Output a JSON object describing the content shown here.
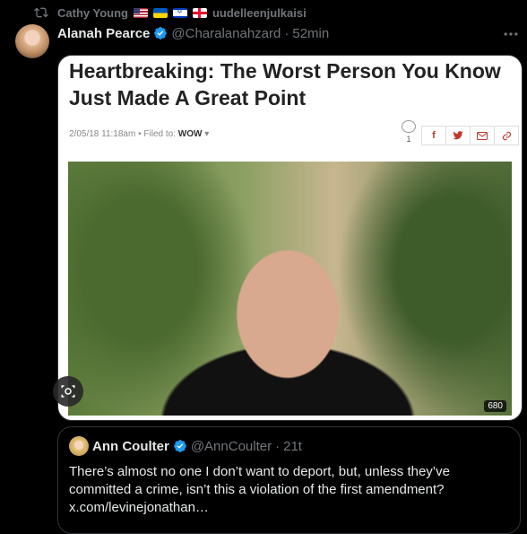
{
  "repost": {
    "user": "Cathy Young",
    "flags": [
      "us",
      "ua",
      "il",
      "ge"
    ],
    "action": "uudelleenjulkaisi"
  },
  "tweet": {
    "author_name": "Alanah Pearce",
    "author_handle": "@Charalanahzard",
    "separator": "·",
    "time": "52min",
    "verified": true,
    "more_icon": "more-horizontal-icon"
  },
  "article": {
    "title": "Heartbreaking: The Worst Person You Know Just Made A Great Point",
    "date": "2/05/18 11:18am",
    "bullet": "•",
    "filed_label": "Filed to:",
    "filed_value": "WOW",
    "comment_count": "1",
    "share_icons": [
      "facebook-icon",
      "twitter-icon",
      "email-icon",
      "link-icon"
    ],
    "photo_badge": "680"
  },
  "quote": {
    "author_name": "Ann Coulter",
    "author_handle": "@AnnCoulter",
    "separator": "·",
    "time": "21t",
    "verified": true,
    "text": "There’s almost no one I don’t want to deport, but, unless they’ve committed a crime, isn’t this a violation of the first amendment? x.com/levinejonathan…"
  },
  "colors": {
    "background": "#000000",
    "text_primary": "#e7e9ea",
    "text_secondary": "#71767b",
    "verified_blue": "#1d9bf0",
    "border": "#2f3336"
  }
}
